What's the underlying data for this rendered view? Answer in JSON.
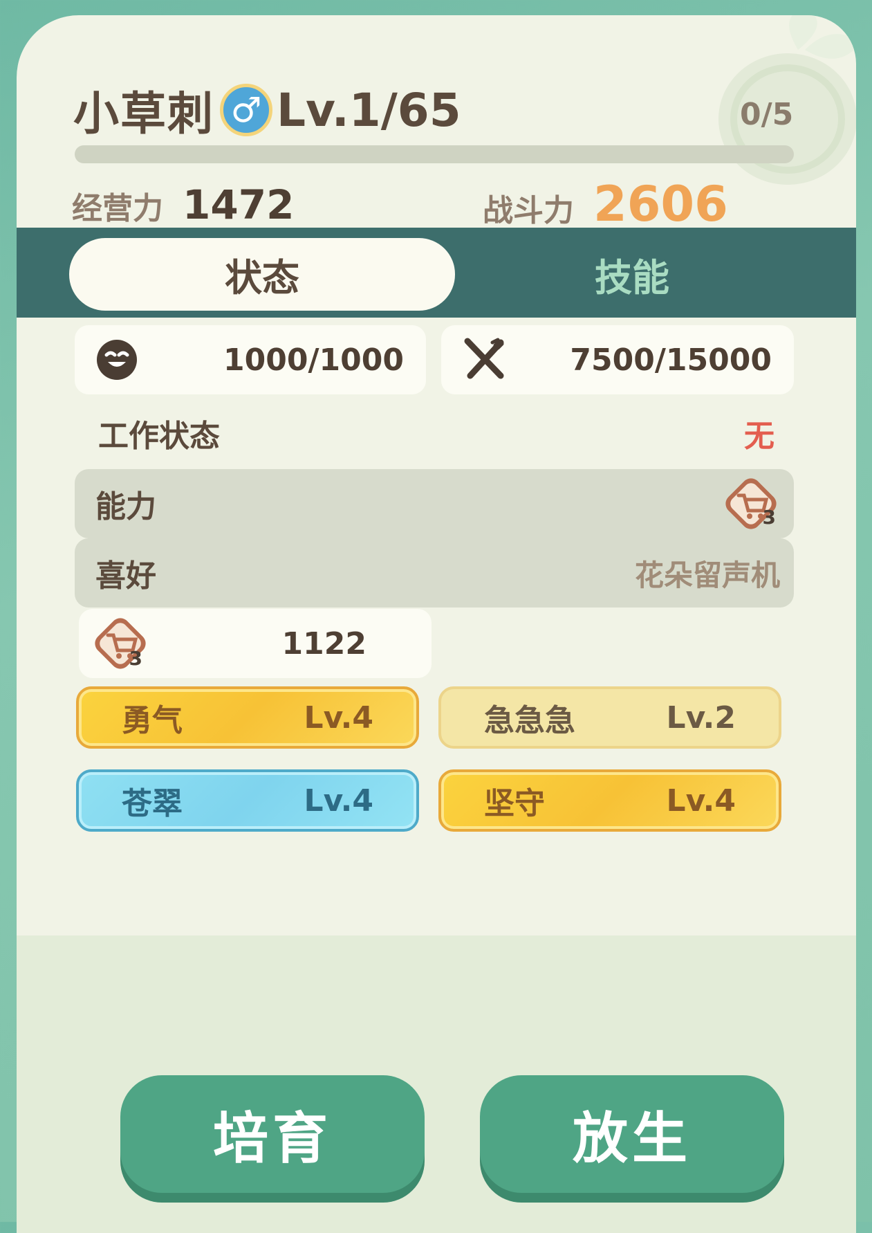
{
  "header": {
    "name": "小草刺",
    "gender_symbol": "♂",
    "level": "Lv.1/65",
    "bond": "0/5",
    "xp_progress": 0
  },
  "stats": {
    "business_label": "经营力",
    "business_value": "1472",
    "combat_label": "战斗力",
    "combat_value": "2606"
  },
  "tabs": {
    "active": "状态",
    "other": "技能"
  },
  "meters": {
    "mood": "1000/1000",
    "food": "7500/15000"
  },
  "work": {
    "label": "工作状态",
    "value": "无"
  },
  "ability": {
    "label": "能力",
    "icon_badge": "3"
  },
  "preference": {
    "label": "喜好",
    "value": "花朵留声机"
  },
  "ability_value": {
    "icon_badge": "3",
    "value": "1122"
  },
  "traits": [
    {
      "name": "勇气",
      "level": "Lv.4"
    },
    {
      "name": "急急急",
      "level": "Lv.2"
    },
    {
      "name": "苍翠",
      "level": "Lv.4"
    },
    {
      "name": "坚守",
      "level": "Lv.4"
    }
  ],
  "buttons": {
    "nurture": "培育",
    "release": "放生"
  },
  "colors": {
    "card_bg": "#f1f3e6",
    "tab_bar": "#3d6e6c",
    "accent_orange": "#f0a456",
    "button_green": "#4fa585",
    "status_red": "#e35e4f"
  },
  "icons": [
    "bond-badge-icon",
    "male-icon",
    "smile-face-icon",
    "fork-knife-icon",
    "cart-icon"
  ]
}
